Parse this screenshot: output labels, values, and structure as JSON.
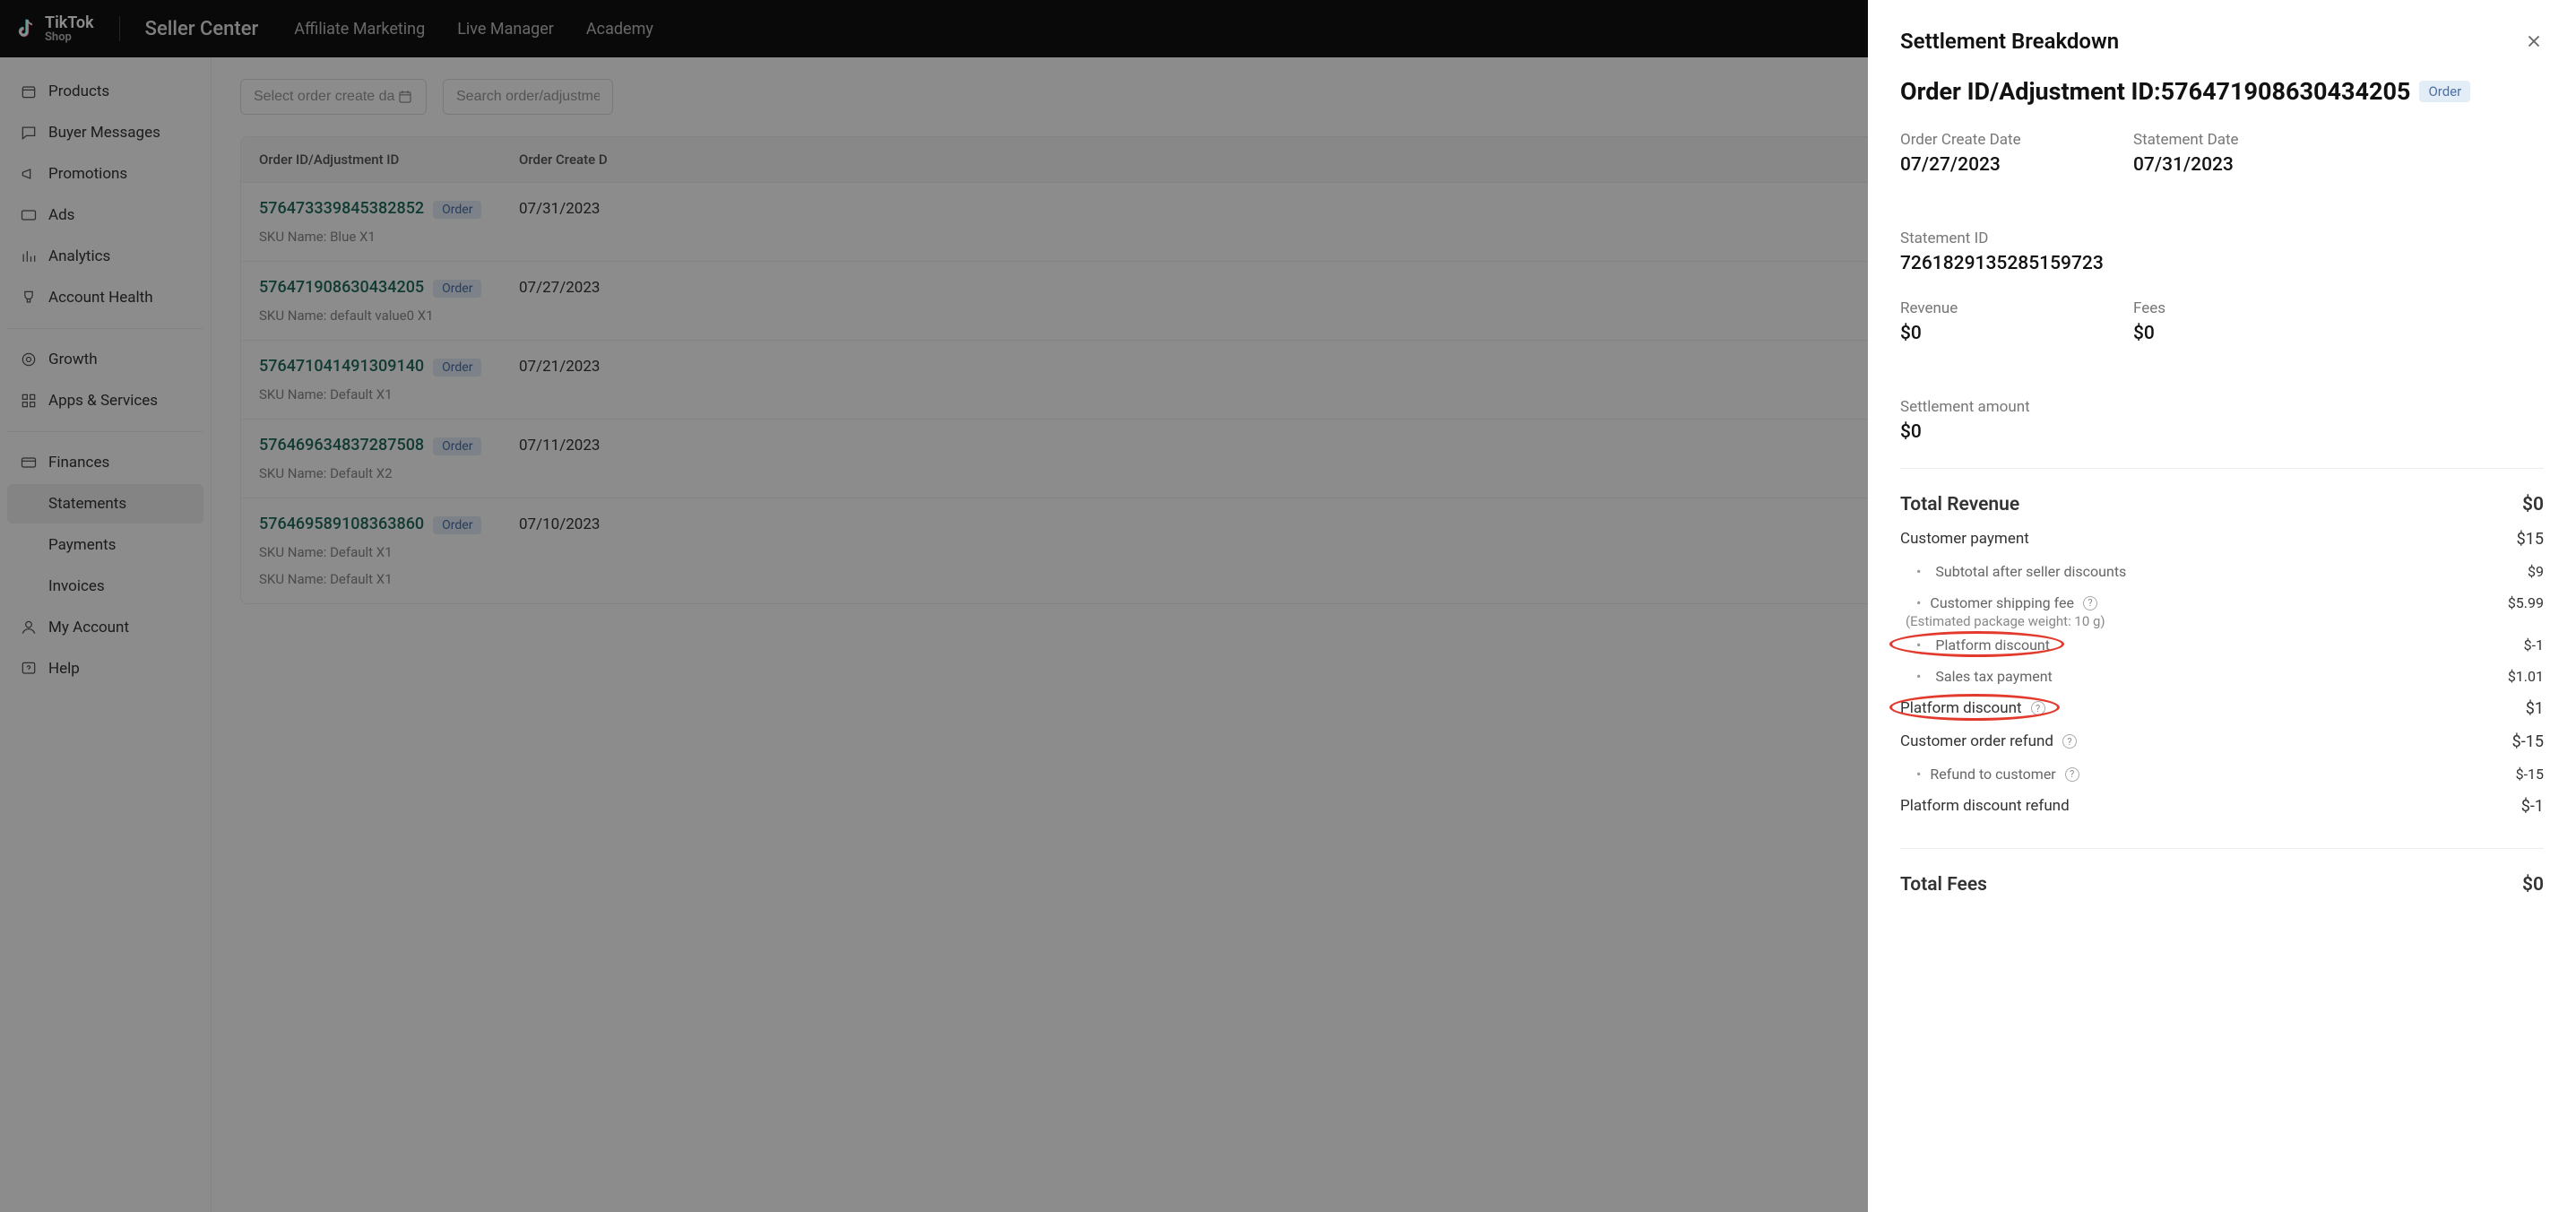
{
  "brand": {
    "name": "TikTok",
    "sub": "Shop",
    "section": "Seller Center"
  },
  "topnav": {
    "affiliate": "Affiliate Marketing",
    "live": "Live Manager",
    "academy": "Academy"
  },
  "sidebar": {
    "products": "Products",
    "buyer": "Buyer Messages",
    "promotions": "Promotions",
    "ads": "Ads",
    "analytics": "Analytics",
    "health": "Account Health",
    "growth": "Growth",
    "apps": "Apps & Services",
    "finances": "Finances",
    "statements": "Statements",
    "payments": "Payments",
    "invoices": "Invoices",
    "account": "My Account",
    "help": "Help"
  },
  "filters": {
    "datePlaceholder": "Select order create da",
    "searchPlaceholder": "Search order/adjustme"
  },
  "table": {
    "header": {
      "id": "Order ID/Adjustment ID",
      "date": "Order Create D"
    },
    "rows": [
      {
        "id": "576473339845382852",
        "badge": "Order",
        "date": "07/31/2023",
        "sku": "SKU Name: Blue X1"
      },
      {
        "id": "576471908630434205",
        "badge": "Order",
        "date": "07/27/2023",
        "sku": "SKU Name: default value0 X1"
      },
      {
        "id": "576471041491309140",
        "badge": "Order",
        "date": "07/21/2023",
        "sku": "SKU Name: Default X1"
      },
      {
        "id": "576469634837287508",
        "badge": "Order",
        "date": "07/11/2023",
        "sku": "SKU Name: Default X2"
      },
      {
        "id": "576469589108363860",
        "badge": "Order",
        "date": "07/10/2023",
        "sku": "SKU Name: Default X1",
        "sku2": "SKU Name: Default X1"
      }
    ]
  },
  "drawer": {
    "title": "Settlement Breakdown",
    "orderLabel": "Order ID/Adjustment ID:",
    "orderId": "576471908630434205",
    "orderBadge": "Order",
    "meta": {
      "createLabel": "Order Create Date",
      "createValue": "07/27/2023",
      "stmtDateLabel": "Statement Date",
      "stmtDateValue": "07/31/2023",
      "stmtIdLabel": "Statement ID",
      "stmtIdValue": "7261829135285159723",
      "revLabel": "Revenue",
      "revValue": "$0",
      "feesLabel": "Fees",
      "feesValue": "$0",
      "settleLabel": "Settlement amount",
      "settleValue": "$0"
    },
    "rev": {
      "totalLabel": "Total Revenue",
      "totalValue": "$0",
      "custPayLabel": "Customer payment",
      "custPayValue": "$15",
      "subtotalLabel": "Subtotal after seller discounts",
      "subtotalValue": "$9",
      "shipLabel": "Customer shipping fee",
      "shipValue": "$5.99",
      "shipNote": "(Estimated package weight: 10 g)",
      "platDiscLabel": "Platform discount",
      "platDiscValue": "$-1",
      "taxLabel": "Sales tax payment",
      "taxValue": "$1.01",
      "platDisc2Label": "Platform discount",
      "platDisc2Value": "$1",
      "refundLabel": "Customer order refund",
      "refundValue": "$-15",
      "refundCustLabel": "Refund to customer",
      "refundCustValue": "$-15",
      "platRefundLabel": "Platform discount refund",
      "platRefundValue": "$-1"
    },
    "fees": {
      "totalLabel": "Total Fees",
      "totalValue": "$0"
    }
  }
}
